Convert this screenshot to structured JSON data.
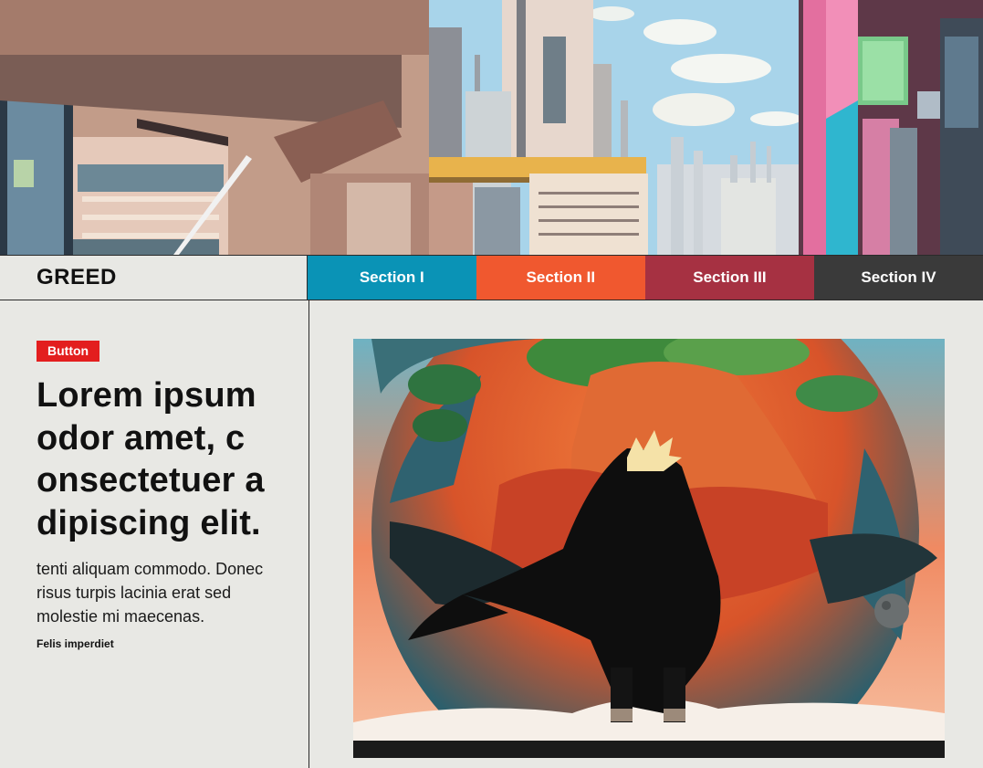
{
  "brand": {
    "name": "GREED"
  },
  "nav": {
    "tabs": [
      {
        "label": "Section I",
        "color": "#0a93b6"
      },
      {
        "label": "Section II",
        "color": "#f0582f"
      },
      {
        "label": "Section III",
        "color": "#a63142"
      },
      {
        "label": "Section IV",
        "color": "#3a3a3a"
      }
    ]
  },
  "article": {
    "button_label": "Button",
    "button_color": "#e31e1e",
    "headline": "Lorem ipsum odor amet, consectetuer adipiscing elit.",
    "body": "tenti aliquam commodo. Donec risus turpis lacinia erat sed molestie mi maecenas.",
    "caption": "Felis imperdiet"
  },
  "images": {
    "hero": "city-street-illustration",
    "feature": "anime-hero-planet-illustration"
  }
}
